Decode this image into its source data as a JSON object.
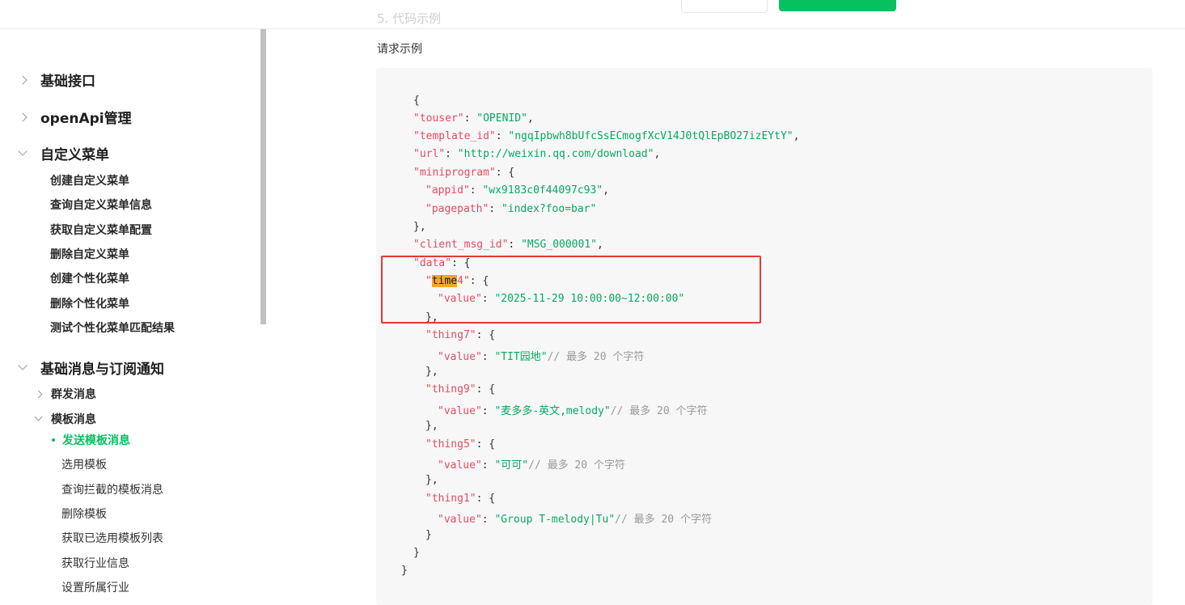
{
  "header": {
    "faded_title": "5. 代码示例"
  },
  "sidebar": {
    "groups": [
      {
        "label": "基础接口",
        "expanded": false
      },
      {
        "label": "openApi管理",
        "expanded": false
      },
      {
        "label": "自定义菜单",
        "expanded": true,
        "items": [
          "创建自定义菜单",
          "查询自定义菜单信息",
          "获取自定义菜单配置",
          "删除自定义菜单",
          "创建个性化菜单",
          "删除个性化菜单",
          "测试个性化菜单匹配结果"
        ]
      },
      {
        "label": "基础消息与订阅通知",
        "expanded": true
      }
    ],
    "sub": {
      "mass_message": "群发消息",
      "template_message": "模板消息",
      "template_items": [
        "发送模板消息",
        "选用模板",
        "查询拦截的模板消息",
        "删除模板",
        "获取已选用模板列表",
        "获取行业信息",
        "设置所属行业"
      ]
    }
  },
  "main": {
    "request_label": "请求示例",
    "code": {
      "open_brace": "{",
      "touser_key": "\"touser\"",
      "touser_val": "\"OPENID\"",
      "template_id_key": "\"template_id\"",
      "template_id_val": "\"ngqIpbwh8bUfcSsECmogfXcV14J0tQlEpBO27izEYtY\"",
      "url_key": "\"url\"",
      "url_val": "\"http://weixin.qq.com/download\"",
      "miniprogram_key": "\"miniprogram\"",
      "appid_key": "\"appid\"",
      "appid_val": "\"wx9183c0f44097c93\"",
      "pagepath_key": "\"pagepath\"",
      "pagepath_val": "\"index?foo=bar\"",
      "client_msg_id_key": "\"client_msg_id\"",
      "client_msg_id_val": "\"MSG_000001\"",
      "data_key": "\"data\"",
      "time_highlight": "time",
      "time_suffix": "4\"",
      "value_key": "\"value\"",
      "time_val": "\"2025-11-29 10:00:00~12:00:00\"",
      "thing7_key": "\"thing7\"",
      "thing7_val": "\"TIT园地\"",
      "thing9_key": "\"thing9\"",
      "thing9_val": "\"麦多多-英文,melody\"",
      "thing5_key": "\"thing5\"",
      "thing5_val": "\"可可\"",
      "thing1_key": "\"thing1\"",
      "thing1_val": "\"Group T-melody|Tu\"",
      "comment": "// 最多 20 个字符",
      "close_brace": "}"
    }
  },
  "colors": {
    "accent_green": "#07c160",
    "code_key": "#e44b63",
    "code_string": "#07a863",
    "highlight_border": "#e53935",
    "search_highlight": "#f7a428"
  }
}
